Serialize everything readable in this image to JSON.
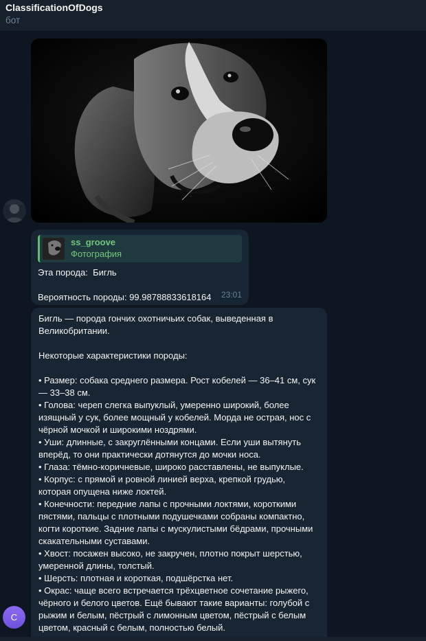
{
  "header": {
    "title": "ClassificationOfDogs",
    "subtitle": "бот"
  },
  "bot_avatar": {
    "letter": "C",
    "color": "#7b5fe8"
  },
  "reply": {
    "quoted_user": "ss_groove",
    "quoted_type": "Фотография",
    "breed_line": "Эта порода:  Бигль",
    "probability_line": "Вероятность породы: 99.98788833618164",
    "time": "23:01"
  },
  "description": {
    "intro": "Бигль — порода гончих охотничьих собак, выведенная в Великобритании.",
    "subheading": "Некоторые характеристики породы:",
    "items": [
      "• Размер: собака среднего размера. Рост кобелей — 36–41 см, сук — 33–38 см.",
      "• Голова: череп слегка выпуклый, умеренно широкий, более изящный у сук, более мощный у кобелей. Морда не острая, нос с чёрной мочкой и широкими ноздрями.",
      "• Уши: длинные, с закруглёнными концами. Если уши вытянуть вперёд, то они практически дотянутся до мочки носа.",
      "• Глаза: тёмно-коричневые, широко расставлены, не выпуклые.",
      "• Корпус: с прямой и ровной линией верха, крепкой грудью, которая опущена ниже локтей.",
      "• Конечности: передние лапы с прочными локтями, короткими пястями, пальцы с плотными подушечками собраны компактно, когти короткие. Задние лапы с мускулистыми бёдрами, прочными скакательными суставами.",
      "• Хвост: посажен высоко, не закручен, плотно покрыт шерстью, умеренной длины, толстый.",
      "• Шерсть: плотная и короткая, подшёрстка нет.",
      "• Окрас: чаще всего встречается трёхцветное сочетание рыжего, чёрного и белого цветов. Ещё бывают такие варианты: голубой с рыжим и белым, пёстрый с лимонным цветом, пёстрый с белым цветом, красный с белым, полностью белый."
    ]
  }
}
